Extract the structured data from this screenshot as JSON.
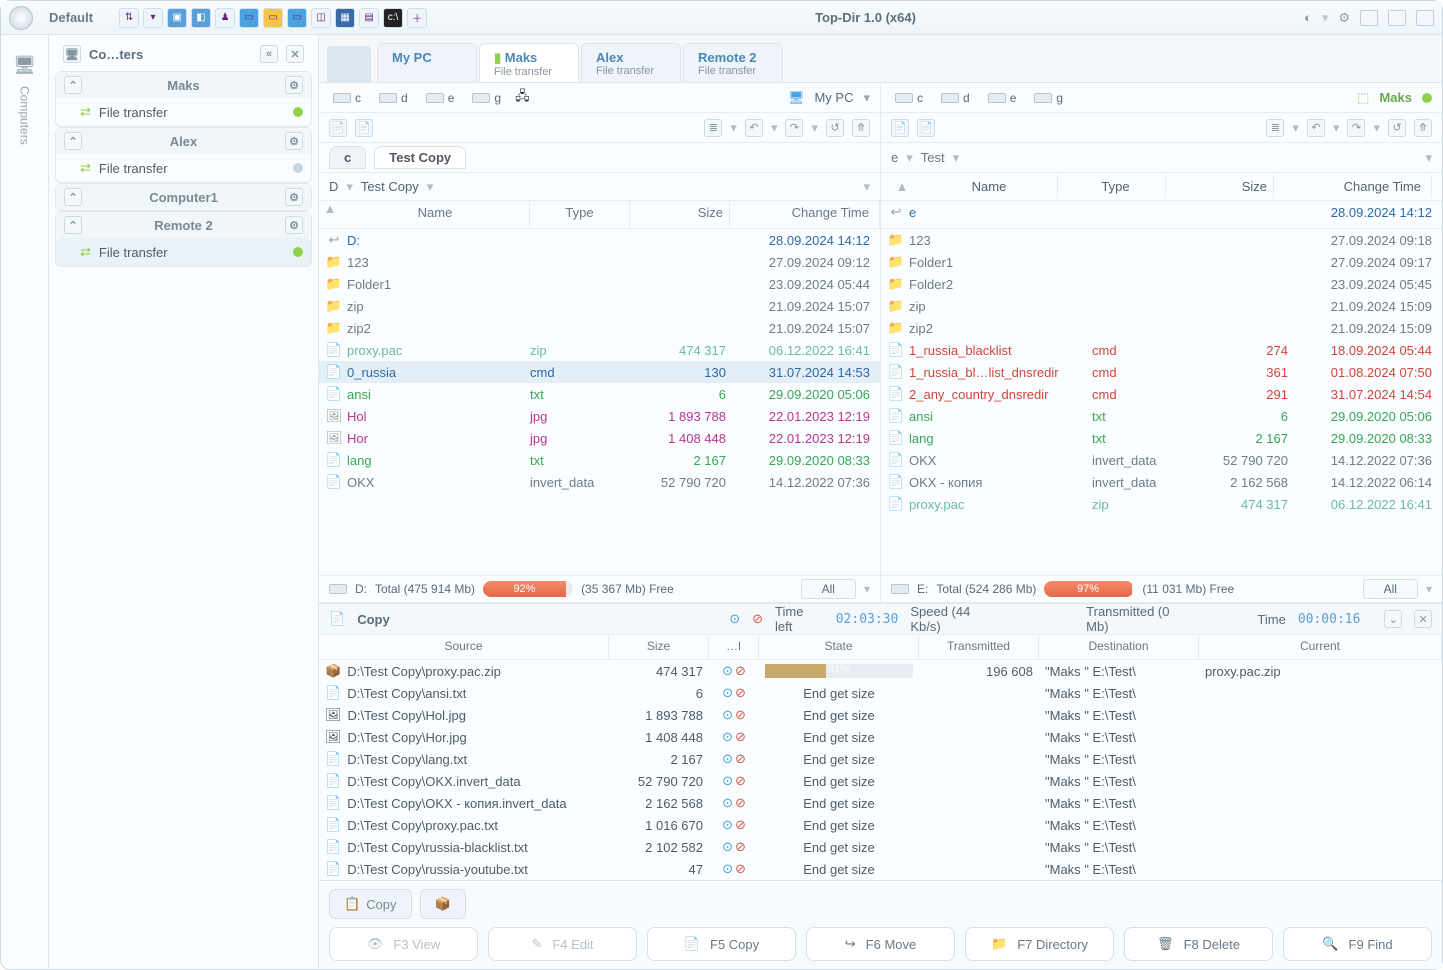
{
  "titlebar": {
    "profile": "Default",
    "title": "Top-Dir 1.0 (x64)"
  },
  "rail": {
    "label": "Computers"
  },
  "sidebar": {
    "title": "Co…ters",
    "groups": [
      {
        "name": "Maks",
        "items": [
          {
            "label": "File transfer",
            "status": "on",
            "selected": false
          }
        ]
      },
      {
        "name": "Alex",
        "items": [
          {
            "label": "File transfer",
            "status": "off",
            "selected": false
          }
        ]
      },
      {
        "name": "Computer1",
        "items": []
      },
      {
        "name": "Remote 2",
        "items": [
          {
            "label": "File transfer",
            "status": "on",
            "selected": true
          }
        ]
      }
    ]
  },
  "tabs": [
    {
      "t1": "My PC",
      "t2": ""
    },
    {
      "t1": "Maks",
      "t2": "File transfer",
      "active": true
    },
    {
      "t1": "Alex",
      "t2": "File transfer"
    },
    {
      "t1": "Remote 2",
      "t2": "File transfer"
    }
  ],
  "drives": {
    "left": [
      "c",
      "d",
      "e",
      "g"
    ],
    "leftLabel": "My PC",
    "right": [
      "c",
      "d",
      "e",
      "g"
    ],
    "rightLabel": "Maks"
  },
  "addr": {
    "leftTabs": [
      "c",
      "Test Copy"
    ],
    "rightTabs": [
      "e",
      "Test"
    ]
  },
  "bread": {
    "leftParts": [
      "D",
      "Test Copy"
    ],
    "rightHeader": {
      "name": "Name",
      "type": "Type",
      "size": "Size",
      "time": "Change Time"
    }
  },
  "cols": {
    "name": "Name",
    "type": "Type",
    "size": "Size",
    "time": "Change Time"
  },
  "leftFiles": [
    {
      "icon": "up",
      "name": "D:",
      "type": "",
      "size": "",
      "time": "28.09.2024 14:12",
      "cls": "c-blue"
    },
    {
      "icon": "fold",
      "name": "123",
      "type": "",
      "size": "",
      "time": "27.09.2024 09:12",
      "cls": "c-gray"
    },
    {
      "icon": "fold",
      "name": "Folder1",
      "type": "",
      "size": "",
      "time": "23.09.2024 05:44",
      "cls": "c-gray"
    },
    {
      "icon": "fold",
      "name": "zip",
      "type": "",
      "size": "",
      "time": "21.09.2024 15:07",
      "cls": "c-gray"
    },
    {
      "icon": "fold",
      "name": "zip2",
      "type": "",
      "size": "",
      "time": "21.09.2024 15:07",
      "cls": "c-gray"
    },
    {
      "icon": "file",
      "name": "proxy.pac",
      "type": "zip",
      "size": "474 317",
      "time": "06.12.2022 16:41",
      "cls": "c-teal"
    },
    {
      "icon": "file",
      "name": "0_russia",
      "type": "cmd",
      "size": "130",
      "time": "31.07.2024 14:53",
      "cls": "c-blue",
      "sel": true
    },
    {
      "icon": "file",
      "name": "ansi",
      "type": "txt",
      "size": "6",
      "time": "29.09.2020 05:06",
      "cls": "c-green"
    },
    {
      "icon": "img",
      "name": "Hol",
      "type": "jpg",
      "size": "1 893 788",
      "time": "22.01.2023 12:19",
      "cls": "c-mag"
    },
    {
      "icon": "img",
      "name": "Hor",
      "type": "jpg",
      "size": "1 408 448",
      "time": "22.01.2023 12:19",
      "cls": "c-mag"
    },
    {
      "icon": "file",
      "name": "lang",
      "type": "txt",
      "size": "2 167",
      "time": "29.09.2020 08:33",
      "cls": "c-green"
    },
    {
      "icon": "file",
      "name": "OKX",
      "type": "invert_data",
      "size": "52 790 720",
      "time": "14.12.2022 07:36",
      "cls": "c-gray"
    }
  ],
  "rightFiles": [
    {
      "icon": "up",
      "name": "e",
      "type": "",
      "size": "",
      "time": "28.09.2024 14:12",
      "cls": "c-blue"
    },
    {
      "icon": "fold",
      "name": "123",
      "type": "",
      "size": "",
      "time": "27.09.2024 09:18",
      "cls": "c-gray"
    },
    {
      "icon": "fold",
      "name": "Folder1",
      "type": "",
      "size": "",
      "time": "27.09.2024 09:17",
      "cls": "c-gray"
    },
    {
      "icon": "fold",
      "name": "Folder2",
      "type": "",
      "size": "",
      "time": "23.09.2024 05:45",
      "cls": "c-gray"
    },
    {
      "icon": "fold",
      "name": "zip",
      "type": "",
      "size": "",
      "time": "21.09.2024 15:09",
      "cls": "c-gray"
    },
    {
      "icon": "fold",
      "name": "zip2",
      "type": "",
      "size": "",
      "time": "21.09.2024 15:09",
      "cls": "c-gray"
    },
    {
      "icon": "file",
      "name": "1_russia_blacklist",
      "type": "cmd",
      "size": "274",
      "time": "18.09.2024 05:44",
      "cls": "c-red"
    },
    {
      "icon": "file",
      "name": "1_russia_bl…list_dnsredir",
      "type": "cmd",
      "size": "361",
      "time": "01.08.2024 07:50",
      "cls": "c-red"
    },
    {
      "icon": "file",
      "name": "2_any_country_dnsredir",
      "type": "cmd",
      "size": "291",
      "time": "31.07.2024 14:54",
      "cls": "c-red"
    },
    {
      "icon": "file",
      "name": "ansi",
      "type": "txt",
      "size": "6",
      "time": "29.09.2020 05:06",
      "cls": "c-green"
    },
    {
      "icon": "file",
      "name": "lang",
      "type": "txt",
      "size": "2 167",
      "time": "29.09.2020 08:33",
      "cls": "c-green"
    },
    {
      "icon": "file",
      "name": "OKX",
      "type": "invert_data",
      "size": "52 790 720",
      "time": "14.12.2022 07:36",
      "cls": "c-gray"
    },
    {
      "icon": "file",
      "name": "OKX - копия",
      "type": "invert_data",
      "size": "2 162 568",
      "time": "14.12.2022 06:14",
      "cls": "c-gray"
    },
    {
      "icon": "file",
      "name": "proxy.pac",
      "type": "zip",
      "size": "474 317",
      "time": "06.12.2022 16:41",
      "cls": "c-teal"
    }
  ],
  "status": {
    "left": {
      "drive": "D:",
      "total": "Total (475 914 Mb)",
      "pct": "92%",
      "pctv": 92,
      "free": "(35 367 Mb) Free",
      "all": "All"
    },
    "right": {
      "drive": "E:",
      "total": "Total (524 286 Mb)",
      "pct": "97%",
      "pctv": 97,
      "free": "(11 031 Mb) Free",
      "all": "All"
    }
  },
  "copy": {
    "title": "Copy",
    "timeleftLbl": "Time left",
    "timeleft": "02:03:30",
    "speed": "Speed (44 Kb/s)",
    "transmitted": "Transmitted (0 Mb)",
    "timeLbl": "Time",
    "time": "00:00:16",
    "cols": {
      "source": "Source",
      "size": "Size",
      "act": "…l",
      "state": "State",
      "trans": "Transmitted",
      "dest": "Destination",
      "cur": "Current"
    },
    "rows": [
      {
        "icon": "zip",
        "src": "D:\\Test Copy\\proxy.pac.zip",
        "size": "474 317",
        "state_prog": 41,
        "trans": "196 608",
        "dest": "\"Maks \" E:\\Test\\",
        "cur": "proxy.pac.zip"
      },
      {
        "icon": "file",
        "src": "D:\\Test Copy\\ansi.txt",
        "size": "6",
        "state": "End get size",
        "dest": "\"Maks \" E:\\Test\\"
      },
      {
        "icon": "img",
        "src": "D:\\Test Copy\\Hol.jpg",
        "size": "1 893 788",
        "state": "End get size",
        "dest": "\"Maks \" E:\\Test\\"
      },
      {
        "icon": "img",
        "src": "D:\\Test Copy\\Hor.jpg",
        "size": "1 408 448",
        "state": "End get size",
        "dest": "\"Maks \" E:\\Test\\"
      },
      {
        "icon": "file",
        "src": "D:\\Test Copy\\lang.txt",
        "size": "2 167",
        "state": "End get size",
        "dest": "\"Maks \" E:\\Test\\"
      },
      {
        "icon": "file",
        "src": "D:\\Test Copy\\OKX.invert_data",
        "size": "52 790 720",
        "state": "End get size",
        "dest": "\"Maks \" E:\\Test\\"
      },
      {
        "icon": "file",
        "src": "D:\\Test Copy\\OKX - копия.invert_data",
        "size": "2 162 568",
        "state": "End get size",
        "dest": "\"Maks \" E:\\Test\\"
      },
      {
        "icon": "file",
        "src": "D:\\Test Copy\\proxy.pac.txt",
        "size": "1 016 670",
        "state": "End get size",
        "dest": "\"Maks \" E:\\Test\\"
      },
      {
        "icon": "file",
        "src": "D:\\Test Copy\\russia-blacklist.txt",
        "size": "2 102 582",
        "state": "End get size",
        "dest": "\"Maks \" E:\\Test\\"
      },
      {
        "icon": "file",
        "src": "D:\\Test Copy\\russia-youtube.txt",
        "size": "47",
        "state": "End get size",
        "dest": "\"Maks \" E:\\Test\\"
      }
    ]
  },
  "dropbar": {
    "copy": "Copy"
  },
  "fn": {
    "f3": "F3 View",
    "f4": "F4 Edit",
    "f5": "F5 Copy",
    "f6": "F6 Move",
    "f7": "F7 Directory",
    "f8": "F8 Delete",
    "f9": "F9 Find"
  }
}
